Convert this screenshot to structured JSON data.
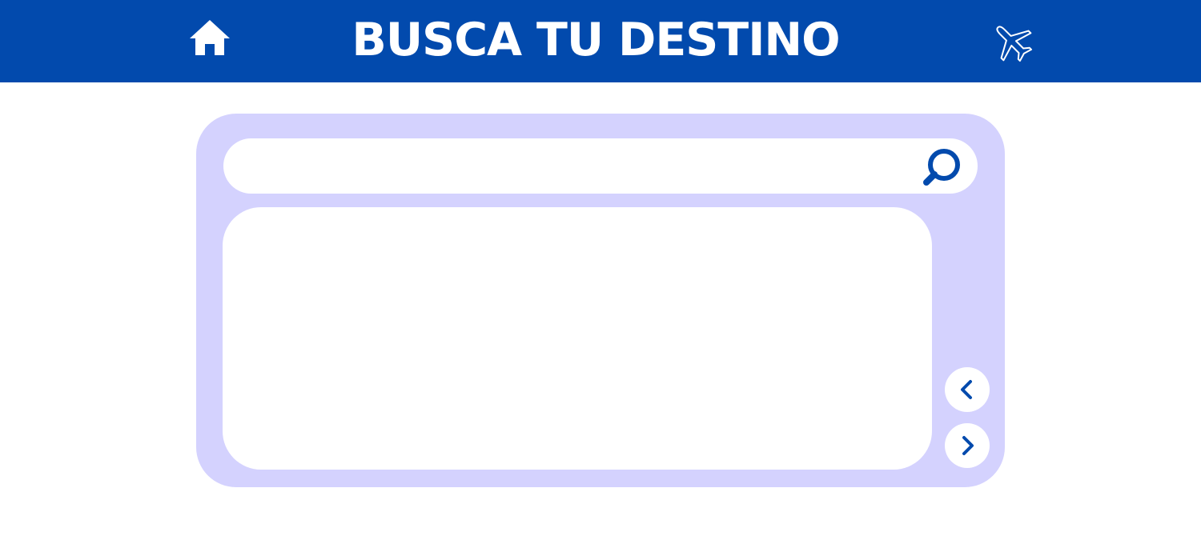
{
  "header": {
    "title": "BUSCA TU DESTINO",
    "home_icon": "home-icon",
    "plane_icon": "airplane-icon"
  },
  "search": {
    "value": "",
    "placeholder": "",
    "icon": "search-icon"
  },
  "carousel": {
    "prev_icon": "chevron-left-icon",
    "next_icon": "chevron-right-icon"
  },
  "colors": {
    "header_bg": "#024aad",
    "panel_bg": "#d4d2fe",
    "accent": "#024aad",
    "surface": "#ffffff"
  }
}
